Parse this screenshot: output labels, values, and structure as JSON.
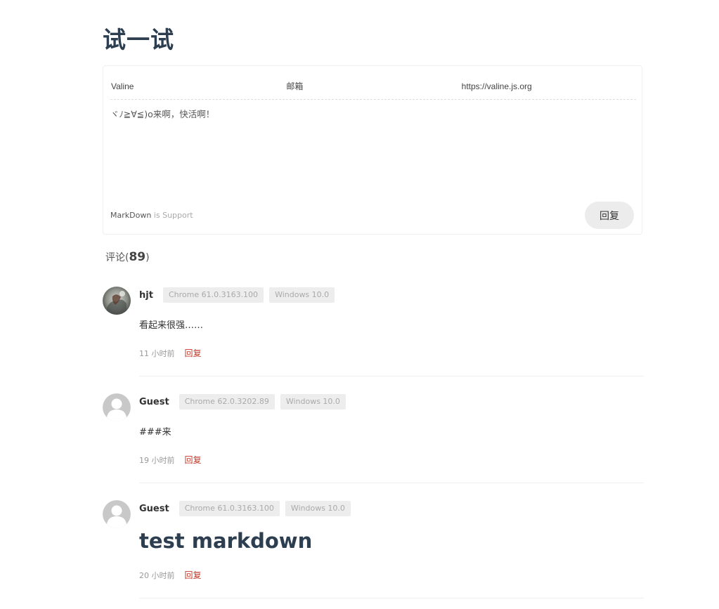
{
  "page": {
    "title": "试一试"
  },
  "editor": {
    "nick_placeholder": "Valine",
    "mail_placeholder": "邮箱",
    "link_placeholder": "https://valine.js.org",
    "comment_placeholder": "ヾﾉ≧∀≦)o来啊，快活啊！",
    "markdown_link": "MarkDown",
    "markdown_suffix": "is Support",
    "submit_label": "回复"
  },
  "comments_header": {
    "label": "评论(",
    "count": "89",
    "close": ")"
  },
  "comments": [
    {
      "nick": "hjt",
      "browser": "Chrome 61.0.3163.100",
      "os": "Windows 10.0",
      "content": "看起来很强……",
      "time": "11 小时前",
      "reply_label": "回复",
      "avatar_icon": "photo-avatar"
    },
    {
      "nick": "Guest",
      "browser": "Chrome 62.0.3202.89",
      "os": "Windows 10.0",
      "content": "###来",
      "time": "19 小时前",
      "reply_label": "回复",
      "avatar_icon": "default-user-avatar"
    },
    {
      "nick": "Guest",
      "browser": "Chrome 61.0.3163.100",
      "os": "Windows 10.0",
      "content": "test markdown",
      "time": "20 小时前",
      "reply_label": "回复",
      "avatar_icon": "default-user-avatar"
    }
  ],
  "colors": {
    "title": "#2c3e50",
    "reply_link": "#c0392b",
    "badge_bg": "#ededed",
    "submit_bg": "#ececec"
  }
}
